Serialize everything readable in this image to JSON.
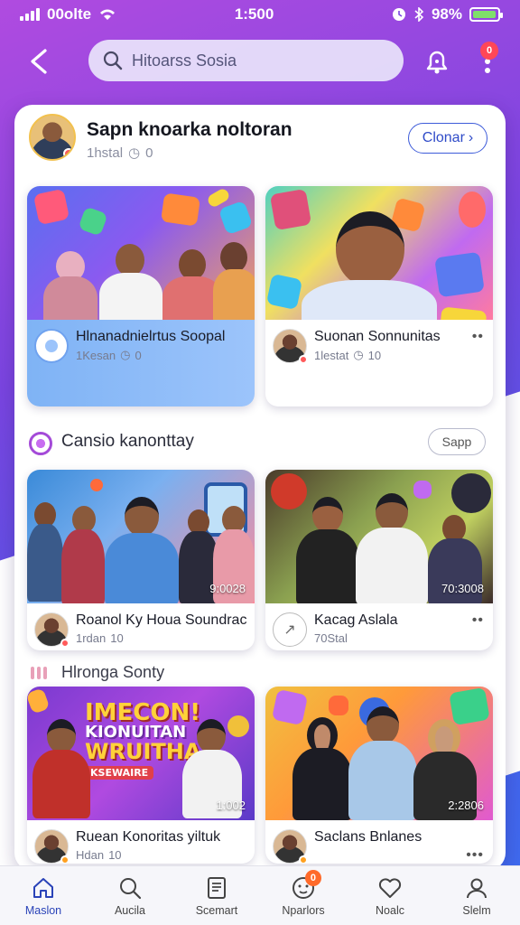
{
  "status_bar": {
    "carrier": "00olte",
    "time": "1:500",
    "battery": "98%",
    "battery_level": 0.98
  },
  "header": {
    "search_placeholder": "Hitoarss Sosia",
    "notif_count": "0"
  },
  "profile": {
    "name": "Sapn knoarka noltoran",
    "sub": "1hstal",
    "sub_count": "0",
    "follow_label": "Clonar"
  },
  "feed1": [
    {
      "title": "Hlnanadnielrtus Soopal",
      "sub": "1Kesan",
      "sub_count": "0"
    },
    {
      "title": "Suonan Sonnunitas",
      "sub": "1lestat",
      "sub_count": "10"
    }
  ],
  "section1": {
    "title": "Cansio kanonttay",
    "button": "Sapp"
  },
  "feed2": [
    {
      "title": "Roanol Ky Houa Soundrac",
      "sub": "1rdan",
      "sub_count": "10",
      "duration": "9:0028"
    },
    {
      "title": "Kacag Aslala",
      "sub": "70Stal",
      "sub_count": "",
      "duration": "70:3008"
    }
  ],
  "section2": {
    "title": "Hlronga Sonty"
  },
  "feed3": [
    {
      "title": "Ruean Konoritas yiltuk",
      "sub": "Hdan",
      "sub_count": "10",
      "duration": "1:002",
      "banner_line1": "IMECON!",
      "banner_line2": "KIONUITAN",
      "banner_line3": "WRUITHAS",
      "banner_line4": "KSEWAIRE"
    },
    {
      "title": "Saclans Bnlanes",
      "sub": "",
      "sub_count": "",
      "duration": "2:2806"
    }
  ],
  "nav": [
    {
      "label": "Maslon",
      "icon": "home-icon"
    },
    {
      "label": "Aucila",
      "icon": "search-icon"
    },
    {
      "label": "Scemart",
      "icon": "document-icon"
    },
    {
      "label": "Nparlors",
      "icon": "face-icon",
      "badge": "0"
    },
    {
      "label": "Noalc",
      "icon": "heart-icon"
    },
    {
      "label": "Slelm",
      "icon": "user-icon"
    }
  ],
  "colors": {
    "accent": "#3d5bd9",
    "badge": "#ff4757",
    "nav_badge": "#ff6a2a",
    "bg_start": "#b04be0",
    "bg_end": "#3d6ef0"
  }
}
